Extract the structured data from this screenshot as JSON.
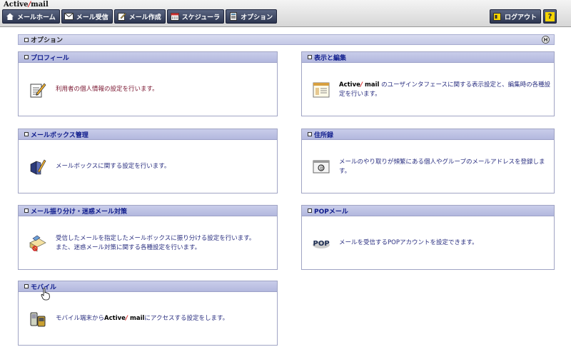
{
  "app": {
    "logo_a": "Active",
    "logo_slash": "/",
    "logo_b": "mail"
  },
  "nav": [
    {
      "label": "メールホーム",
      "icon": "home-icon"
    },
    {
      "label": "メール受信",
      "icon": "envelope-icon"
    },
    {
      "label": "メール作成",
      "icon": "compose-icon"
    },
    {
      "label": "スケジューラ",
      "icon": "calendar-icon"
    },
    {
      "label": "オプション",
      "icon": "options-icon"
    }
  ],
  "logout": {
    "label": "ログアウト",
    "icon": "logout-icon"
  },
  "help": {
    "label": "?"
  },
  "header": {
    "title": "オプション",
    "collapse": "H"
  },
  "panels": {
    "profile": {
      "title": "プロフィール",
      "desc": "利用者の個人情報の設定を行います。",
      "icon": "profile-edit-icon"
    },
    "display": {
      "title": "表示と編集",
      "desc_prefix": "",
      "brand_a": "Active",
      "brand_slash": "/",
      "brand_b": " mail",
      "desc_suffix": "のユーザインタフェースに関する表示設定と、編集時の各種設定を行います。",
      "icon": "display-window-icon"
    },
    "mailbox": {
      "title": "メールボックス管理",
      "desc": "メールボックスに関する設定を行います。",
      "icon": "mailbox-edit-icon"
    },
    "addressbook": {
      "title": "住所録",
      "desc": "メールのやり取りが頻繁にある個人やグループのメールアドレスを登録します。",
      "icon": "address-book-icon"
    },
    "filter": {
      "title": "メール振り分け・迷惑メール対策",
      "desc_line1": "受信したメールを指定したメールボックスに振り分ける設定を行います。",
      "desc_line2": "また、迷惑メール対策に関する各種設定を行います。",
      "icon": "mail-filter-icon"
    },
    "pop": {
      "title": "POPメール",
      "desc": "メールを受信するPOPアカウントを設定できます。",
      "icon": "pop-icon",
      "icon_text": "POP"
    },
    "mobile": {
      "title": "モバイル",
      "desc_prefix": "モバイル端末から",
      "brand_a": "Active",
      "brand_slash": "/",
      "brand_b": " mail",
      "desc_suffix": "にアクセスする設定をします。",
      "icon": "mobile-phone-icon"
    }
  },
  "colors": {
    "nav_bg": "#2c3550",
    "panel_title": "#0e1b8c",
    "header_bg": "#c4c8e6",
    "accent_red": "#d81e1e"
  }
}
